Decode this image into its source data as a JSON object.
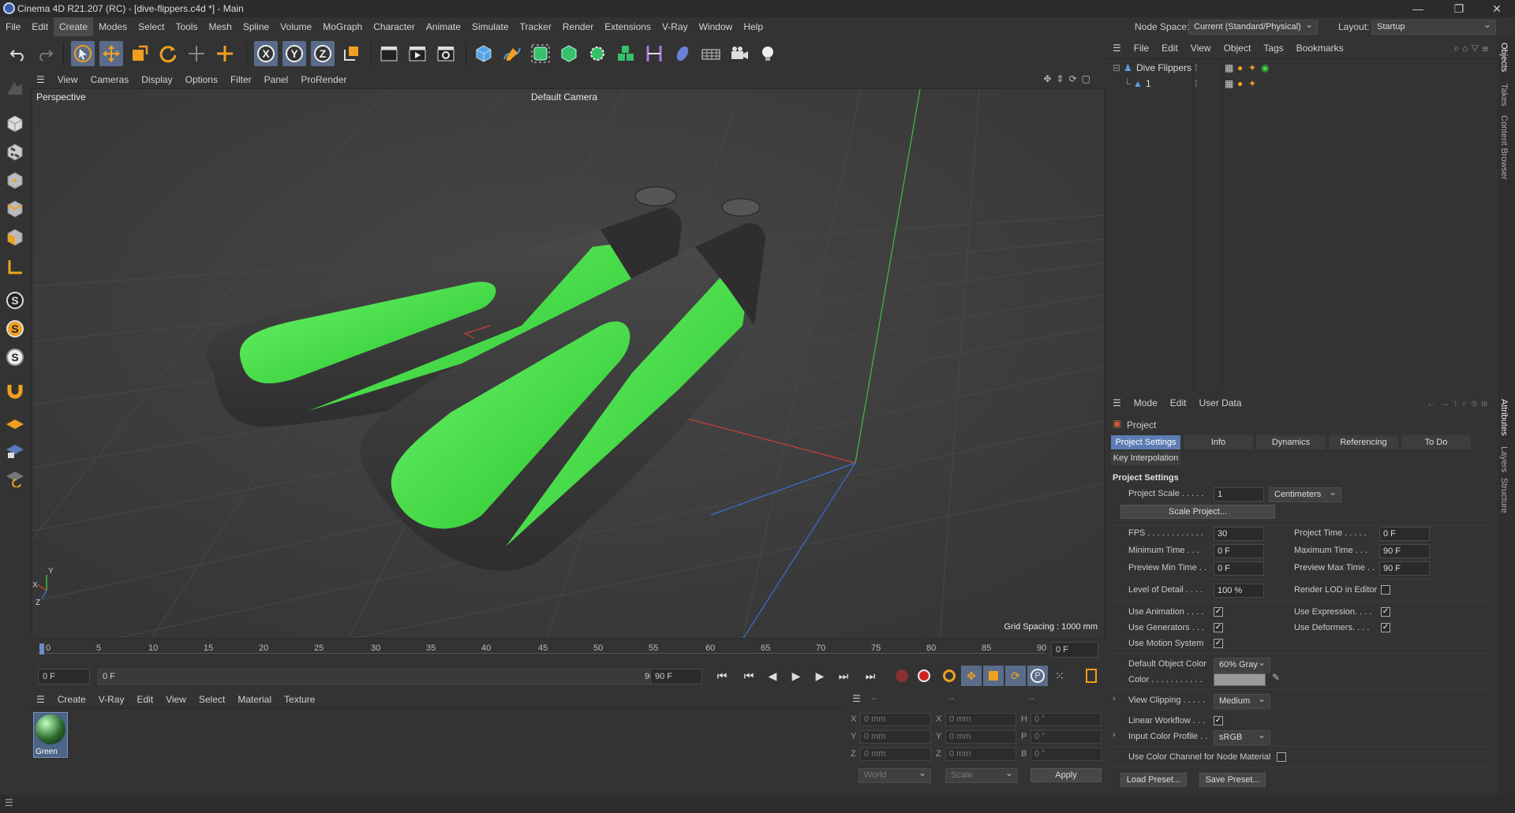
{
  "window": {
    "title": "Cinema 4D R21.207 (RC) - [dive-flippers.c4d *] - Main",
    "minimize": "—",
    "maximize": "❐",
    "close": "✕"
  },
  "menu": [
    "File",
    "Edit",
    "Create",
    "Modes",
    "Select",
    "Tools",
    "Mesh",
    "Spline",
    "Volume",
    "MoGraph",
    "Character",
    "Animate",
    "Simulate",
    "Tracker",
    "Render",
    "Extensions",
    "V-Ray",
    "Window",
    "Help"
  ],
  "header_right": {
    "node_space_label": "Node Space:",
    "node_space_value": "Current (Standard/Physical)",
    "layout_label": "Layout:",
    "layout_value": "Startup"
  },
  "viewport": {
    "menu": [
      "View",
      "Cameras",
      "Display",
      "Options",
      "Filter",
      "Panel",
      "ProRender"
    ],
    "name": "Perspective",
    "camera": "Default Camera",
    "grid_spacing": "Grid Spacing : 1000 mm",
    "axis_labels": {
      "x": "X",
      "y": "Y",
      "z": "Z"
    }
  },
  "timeline": {
    "ticks": [
      "0",
      "5",
      "10",
      "15",
      "20",
      "25",
      "30",
      "35",
      "40",
      "45",
      "50",
      "55",
      "60",
      "65",
      "70",
      "75",
      "80",
      "85",
      "90"
    ],
    "current_frame": "0 F",
    "start": "0 F",
    "range_start": "0 F",
    "range_end": "90 F",
    "end": "90 F"
  },
  "material_manager": {
    "menu": [
      "Create",
      "V-Ray",
      "Edit",
      "View",
      "Select",
      "Material",
      "Texture"
    ],
    "materials": [
      {
        "name": "Green"
      }
    ]
  },
  "coordinates": {
    "header_dashes": [
      "--",
      "--",
      "--"
    ],
    "rows": [
      {
        "a_label": "X",
        "a": "0 mm",
        "b_label": "X",
        "b": "0 mm",
        "c_label": "H",
        "c": "0 °"
      },
      {
        "a_label": "Y",
        "a": "0 mm",
        "b_label": "Y",
        "b": "0 mm",
        "c_label": "P",
        "c": "0 °"
      },
      {
        "a_label": "Z",
        "a": "0 mm",
        "b_label": "Z",
        "b": "0 mm",
        "c_label": "B",
        "c": "0 °"
      }
    ],
    "space": "World",
    "mode": "Scale",
    "apply": "Apply"
  },
  "object_manager": {
    "menu": [
      "File",
      "Edit",
      "View",
      "Object",
      "Tags",
      "Bookmarks"
    ],
    "objects": [
      {
        "name": "Dive Flippers"
      },
      {
        "name": "1"
      }
    ]
  },
  "right_tabs": [
    "Objects",
    "Takes",
    "Content Browser",
    "Attributes",
    "Layers",
    "Structure"
  ],
  "attributes": {
    "menu": [
      "Mode",
      "Edit",
      "User Data"
    ],
    "title": "Project",
    "tabs": [
      "Project Settings",
      "Info",
      "Dynamics",
      "Referencing",
      "To Do"
    ],
    "tab2": "Key Interpolation",
    "section": "Project Settings",
    "project_scale_label": "Project Scale . . . . .",
    "project_scale": "1",
    "project_scale_unit": "Centimeters",
    "scale_project_btn": "Scale Project...",
    "fps_label": "FPS . . . . . . . . . . . .",
    "fps": "30",
    "project_time_label": "Project Time . . . . .",
    "project_time": "0 F",
    "min_time_label": "Minimum Time . . .",
    "min_time": "0 F",
    "max_time_label": "Maximum Time . . .",
    "max_time": "90 F",
    "prev_min_label": "Preview Min Time . .",
    "prev_min": "0 F",
    "prev_max_label": "Preview Max Time . .",
    "prev_max": "90 F",
    "lod_label": "Level of Detail . . . .",
    "lod": "100 %",
    "render_lod_label": "Render LOD in Editor",
    "use_animation_label": "Use Animation . . . .",
    "use_expression_label": "Use Expression. . . .",
    "use_generators_label": "Use Generators . . .",
    "use_deformers_label": "Use Deformers. . . .",
    "use_motion_label": "Use Motion System",
    "default_color_label": "Default Object Color",
    "default_color": "60% Gray",
    "color_label": "Color . . . . . . . . . . .",
    "view_clipping_label": "View Clipping . . . . .",
    "view_clipping": "Medium",
    "linear_workflow_label": "Linear Workflow . . .",
    "input_profile_label": "Input Color Profile . .",
    "input_profile": "sRGB",
    "use_color_channel_label": "Use Color Channel for Node Material",
    "load_preset": "Load Preset...",
    "save_preset": "Save Preset..."
  },
  "colors": {
    "accent": "#5d7cb4",
    "flipper_green": "#3ddc3a",
    "flipper_dark": "#3a3a3a"
  }
}
